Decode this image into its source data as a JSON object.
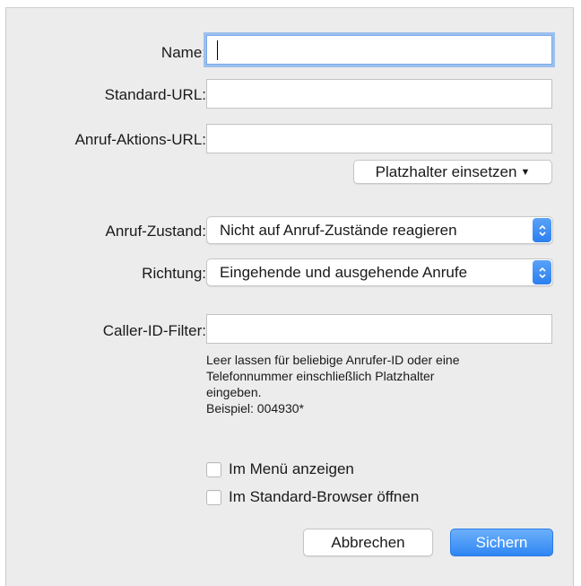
{
  "form": {
    "name": {
      "label": "Name:",
      "value": "",
      "placeholder": ""
    },
    "default_url": {
      "label": "Standard-URL:",
      "value": "",
      "placeholder": ""
    },
    "call_action_url": {
      "label": "Anruf-Aktions-URL:",
      "value": "",
      "placeholder": ""
    },
    "insert_placeholder_label": "Platzhalter einsetzen",
    "call_state": {
      "label": "Anruf-Zustand:",
      "selected": "Nicht auf Anruf-Zustände reagieren"
    },
    "direction": {
      "label": "Richtung:",
      "selected": "Eingehende und ausgehende Anrufe"
    },
    "caller_id_filter": {
      "label": "Caller-ID-Filter:",
      "value": "",
      "placeholder": ""
    },
    "hint": {
      "line1": "Leer lassen für beliebige Anrufer-ID oder eine",
      "line2": "Telefonnummer einschließlich Platzhalter",
      "line3": "eingeben.",
      "example": "Beispiel: 004930*"
    },
    "show_in_menu": {
      "label": "Im Menü anzeigen",
      "checked": false
    },
    "open_in_default_browser": {
      "label": "Im Standard-Browser öffnen",
      "checked": false
    }
  },
  "buttons": {
    "cancel_label": "Abbrechen",
    "save_label": "Sichern"
  },
  "icons": {
    "dropdown_caret": "chevron-down-icon",
    "popup_stepper": "up-down-chevron-icon"
  },
  "colors": {
    "accent": "#2f86f3",
    "focus_ring": "#9cc0ee",
    "sheet_background": "#ececec"
  }
}
